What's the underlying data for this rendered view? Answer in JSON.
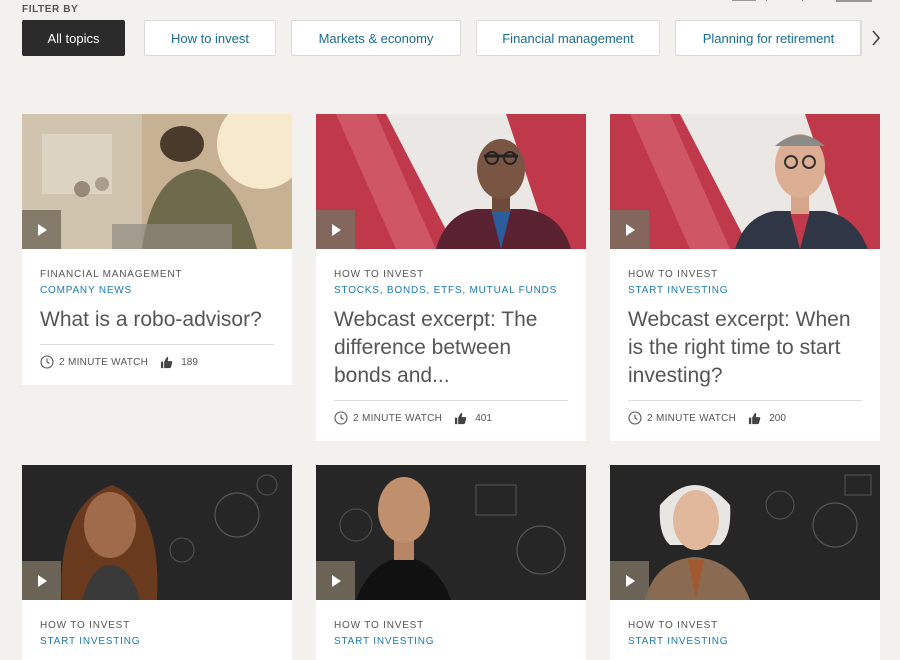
{
  "filter": {
    "label": "FILTER BY",
    "chips": [
      {
        "label": "All topics",
        "active": true
      },
      {
        "label": "How to invest",
        "active": false
      },
      {
        "label": "Markets & economy",
        "active": false
      },
      {
        "label": "Financial management",
        "active": false
      },
      {
        "label": "Planning for retirement",
        "active": false
      }
    ]
  },
  "cards": [
    {
      "category": "FINANCIAL MANAGEMENT",
      "subcategory": "COMPANY NEWS",
      "title": "What is a robo-advisor?",
      "watch": "2 MINUTE WATCH",
      "likes": "189"
    },
    {
      "category": "HOW TO INVEST",
      "subcategory": "STOCKS, BONDS, ETFS, MUTUAL FUNDS",
      "title": "Webcast excerpt: The difference between bonds and...",
      "watch": "2 MINUTE WATCH",
      "likes": "401"
    },
    {
      "category": "HOW TO INVEST",
      "subcategory": "START INVESTING",
      "title": "Webcast excerpt: When is the right time to start investing?",
      "watch": "2 MINUTE WATCH",
      "likes": "200"
    },
    {
      "category": "HOW TO INVEST",
      "subcategory": "START INVESTING"
    },
    {
      "category": "HOW TO INVEST",
      "subcategory": "START INVESTING"
    },
    {
      "category": "HOW TO INVEST",
      "subcategory": "START INVESTING"
    }
  ],
  "colors": {
    "accent_link": "#1a7ab0",
    "active_chip": "#2b2b2b",
    "brand_red": "#c0394a"
  }
}
